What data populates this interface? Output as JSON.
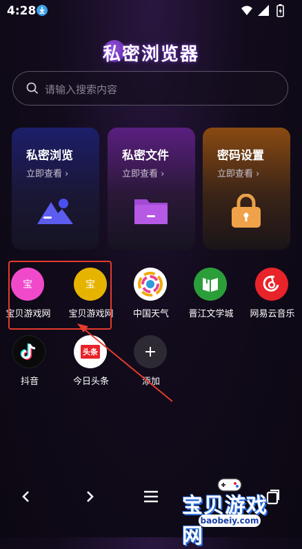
{
  "status_bar": {
    "time": "4:28"
  },
  "header": {
    "title": "私密浏览器"
  },
  "search": {
    "placeholder": "请输入搜索内容"
  },
  "cards": [
    {
      "title": "私密浏览",
      "subtitle": "立即查看 ›",
      "icon": "image-icon",
      "accent": "#3b3fd8"
    },
    {
      "title": "私密文件",
      "subtitle": "立即查看 ›",
      "icon": "folder-icon",
      "accent": "#b23ad8"
    },
    {
      "title": "密码设置",
      "subtitle": "立即查看 ›",
      "icon": "lock-icon",
      "accent": "#f09a2a"
    }
  ],
  "apps": [
    {
      "label": "宝贝游戏网",
      "glyph": "宝",
      "color": "#f04acb"
    },
    {
      "label": "宝贝游戏网",
      "glyph": "宝",
      "color": "#e6b400"
    },
    {
      "label": "中国天气",
      "icon": "weather-icon"
    },
    {
      "label": "晋江文学城",
      "icon": "book-icon"
    },
    {
      "label": "网易云音乐",
      "icon": "music-icon"
    },
    {
      "label": "抖音",
      "icon": "tiktok-icon"
    },
    {
      "label": "今日头条",
      "icon": "toutiao-icon",
      "badge": "头条"
    },
    {
      "label": "添加",
      "icon": "plus-icon"
    }
  ],
  "watermark": {
    "text": "宝贝游戏网",
    "url": "baobeiy.com"
  }
}
